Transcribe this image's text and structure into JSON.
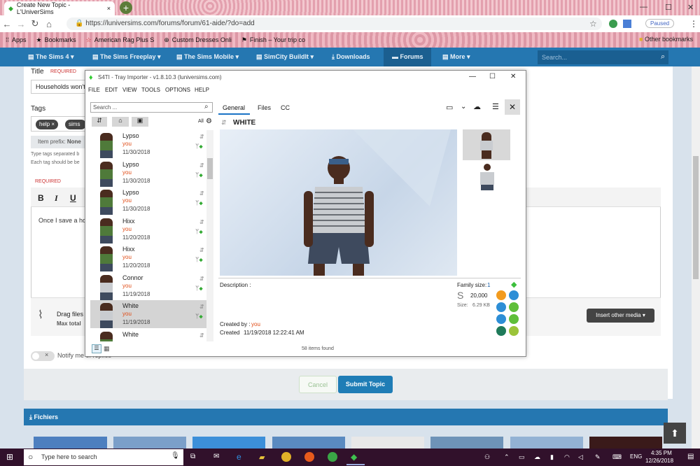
{
  "browser": {
    "tab_title": "Create New Topic - L'UniverSims",
    "url": "https://luniversims.com/forums/forum/61-aide/?do=add",
    "profile": "Paused",
    "bookmarks": [
      {
        "label": "Apps",
        "icon": "apps-grid"
      },
      {
        "label": "Bookmarks",
        "icon": "star"
      },
      {
        "label": "American Rag Plus S",
        "icon": "star"
      },
      {
        "label": "Custom Dresses Onli",
        "icon": "globe"
      },
      {
        "label": "Finish – Your trip co",
        "icon": "flag"
      }
    ],
    "other_bookmarks": "Other bookmarks"
  },
  "site_nav": {
    "items": [
      {
        "label": "The Sims 4 ▾"
      },
      {
        "label": "The Sims Freeplay ▾"
      },
      {
        "label": "The Sims Mobile ▾"
      },
      {
        "label": "SimCity BuildIt ▾"
      },
      {
        "label": "Downloads"
      },
      {
        "label": "Forums"
      },
      {
        "label": "More ▾"
      }
    ],
    "search_placeholder": "Search..."
  },
  "form": {
    "title_label": "Title",
    "required": "REQUIRED",
    "title_value": "Households won't",
    "tags_label": "Tags",
    "tags": [
      "help ×",
      "sims 4"
    ],
    "prefix_label": "Item prefix:",
    "prefix_value": "None",
    "tags_help1": "Type tags separated b",
    "tags_help2": "Each tag should be be",
    "editor_text": "Once I save a ho",
    "drag_files": "Drag files",
    "max_total": "Max total",
    "insert_media": "Insert other media ▾",
    "notify": "Notify me of replies",
    "cancel": "Cancel",
    "submit": "Submit Topic",
    "files_section": "Fichiers"
  },
  "app": {
    "title": "S4TI - Tray Importer - v1.8.10.3  (luniversims.com)",
    "menu": [
      "FILE",
      "EDIT",
      "VIEW",
      "TOOLS",
      "OPTIONS",
      "HELP"
    ],
    "search_placeholder": "Search ...",
    "filter_all": "All",
    "items": [
      {
        "name": "Lypso",
        "who": "you",
        "date": "11/30/2018"
      },
      {
        "name": "Lypso",
        "who": "you",
        "date": "11/30/2018"
      },
      {
        "name": "Lypso",
        "who": "you",
        "date": "11/30/2018"
      },
      {
        "name": "Hixx",
        "who": "you",
        "date": "11/20/2018"
      },
      {
        "name": "Hixx",
        "who": "you",
        "date": "11/20/2018"
      },
      {
        "name": "Connor",
        "who": "you",
        "date": "11/19/2018"
      },
      {
        "name": "White",
        "who": "you",
        "date": "11/19/2018"
      },
      {
        "name": "White",
        "who": "",
        "date": ""
      }
    ],
    "tabs": [
      "General",
      "Files",
      "CC"
    ],
    "household_name": "WHITE",
    "description_label": "Description :",
    "family_size_label": "Family size:",
    "family_size": "1",
    "funds": "20,000",
    "size_label": "Size:",
    "size": "6.29 KB",
    "created_by_label": "Created by :",
    "created_by": "you",
    "created_label": "Created",
    "created_date": "11/19/2018 12:22:41 AM",
    "status": "58 items found"
  },
  "taskbar": {
    "search_placeholder": "Type here to search",
    "lang": "ENG",
    "time": "4:35 PM",
    "date": "12/26/2018"
  },
  "colors": {
    "nav": "#2577b1",
    "accent": "#1c7ec2",
    "orange": "#e04a14"
  }
}
